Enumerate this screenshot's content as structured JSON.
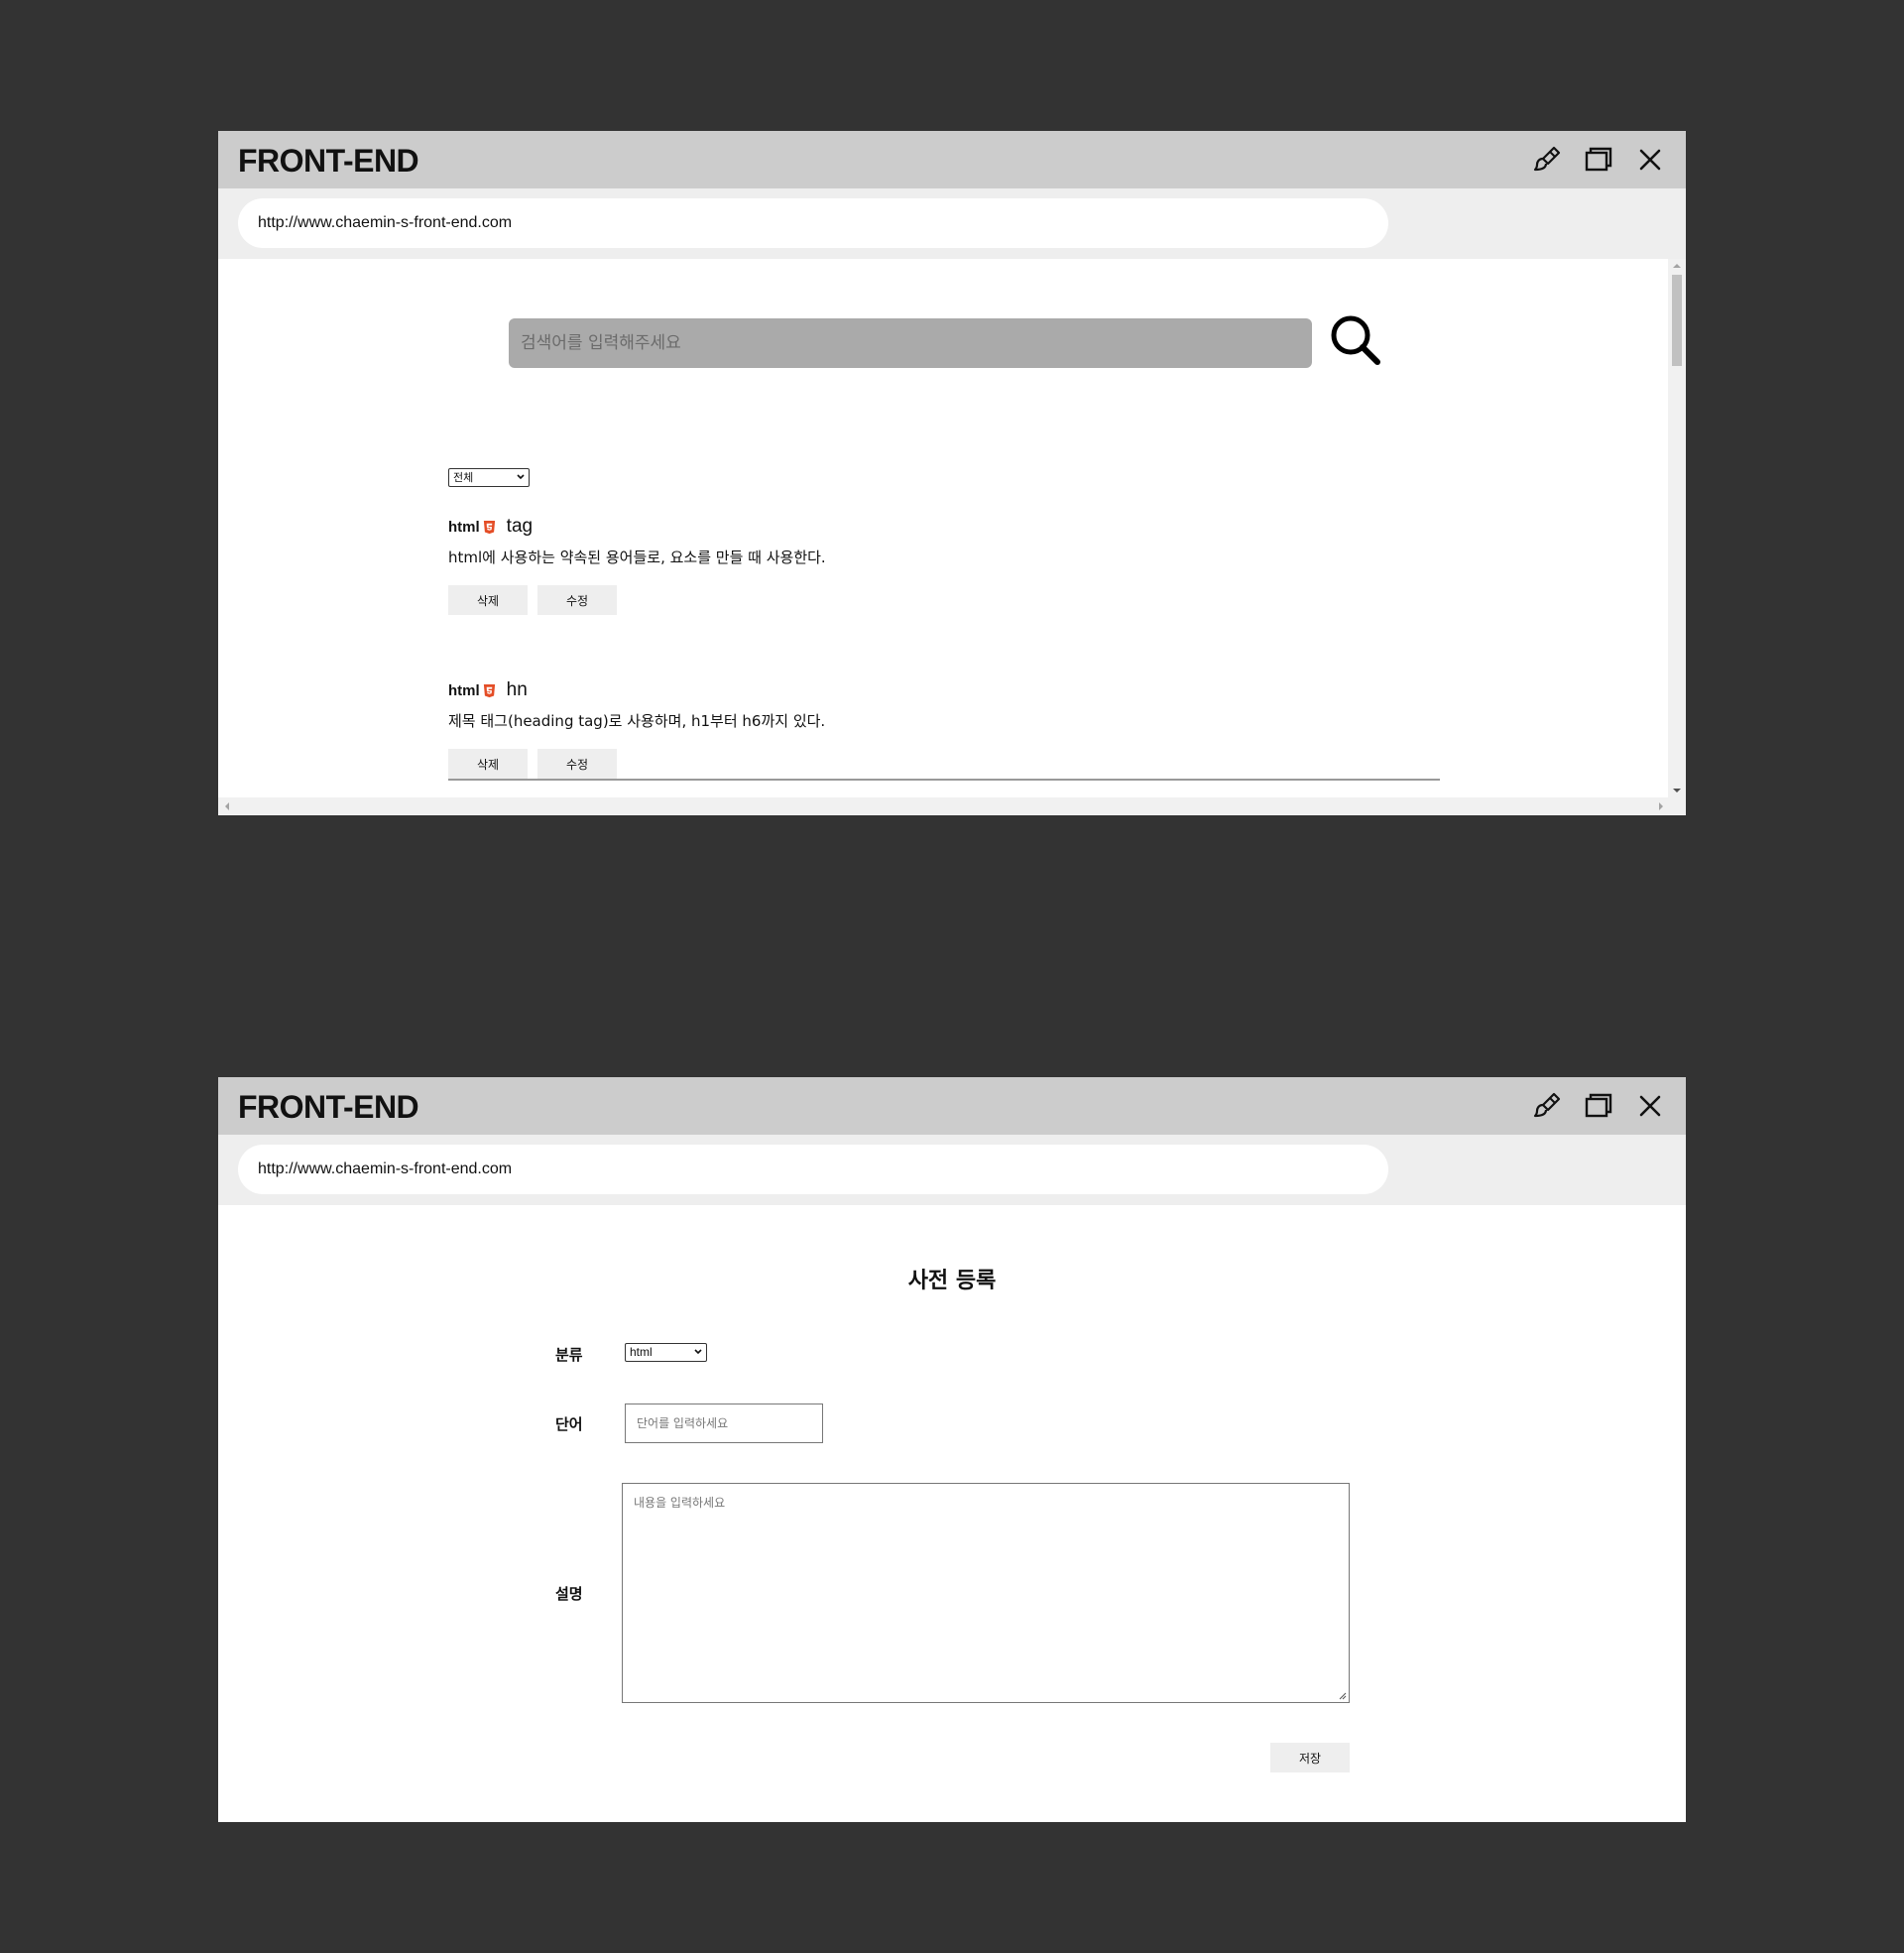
{
  "browser": {
    "title": "FRONT-END",
    "url": "http://www.chaemin-s-front-end.com",
    "icons": [
      "brush-icon",
      "window-icon",
      "close-icon"
    ]
  },
  "list_page": {
    "search": {
      "placeholder": "검색어를 입력해주세요"
    },
    "filter": {
      "selected": "전체"
    },
    "entries": [
      {
        "category": "html",
        "term": "tag",
        "description": "html에 사용하는 약속된 용어들로, 요소를 만들 때 사용한다.",
        "delete_label": "삭제",
        "edit_label": "수정"
      },
      {
        "category": "html",
        "term": "hn",
        "description": "제목 태그(heading tag)로 사용하며, h1부터 h6까지 있다.",
        "delete_label": "삭제",
        "edit_label": "수정"
      }
    ]
  },
  "form_page": {
    "heading": "사전 등록",
    "category_label": "분류",
    "category_selected": "html",
    "word_label": "단어",
    "word_placeholder": "단어를 입력하세요",
    "description_label": "설명",
    "description_placeholder": "내용을 입력하세요",
    "save_label": "저장"
  },
  "colors": {
    "background": "#333333",
    "titlebar": "#cccccc",
    "addrbar": "#eeeeee",
    "search_box": "#aaaaaa",
    "html5_badge": "#e44d26"
  }
}
